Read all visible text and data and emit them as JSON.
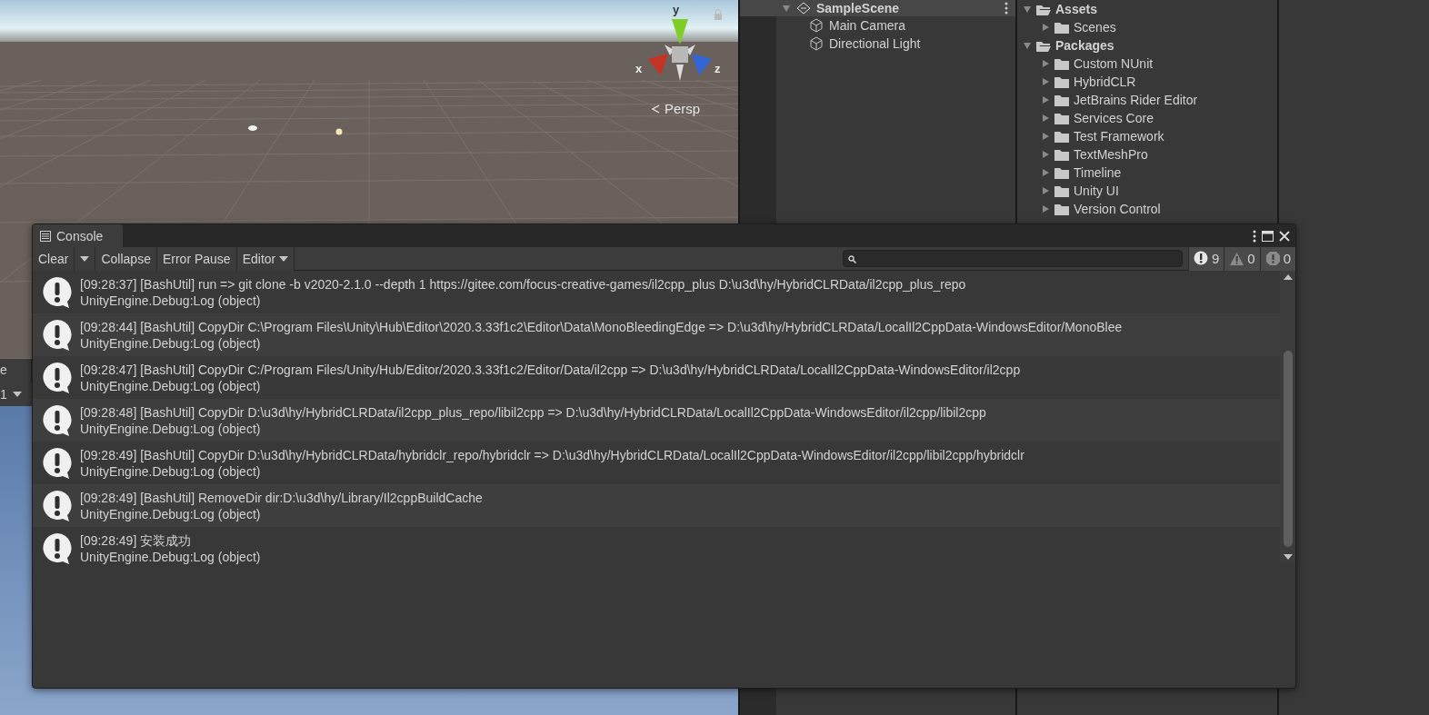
{
  "scene_view": {
    "gizmo_axes": [
      "y",
      "x",
      "z"
    ],
    "projection": "Persp"
  },
  "game_view": {
    "tab": "e",
    "display": "1"
  },
  "hierarchy": {
    "scene": "SampleScene",
    "items": [
      "Main Camera",
      "Directional Light"
    ]
  },
  "project": {
    "tree": [
      {
        "label": "Assets",
        "expanded": true,
        "children": [
          {
            "label": "Scenes",
            "expanded": false
          }
        ]
      },
      {
        "label": "Packages",
        "expanded": true,
        "children": [
          {
            "label": "Custom NUnit",
            "expanded": false
          },
          {
            "label": "HybridCLR",
            "expanded": false
          },
          {
            "label": "JetBrains Rider Editor",
            "expanded": false
          },
          {
            "label": "Services Core",
            "expanded": false
          },
          {
            "label": "Test Framework",
            "expanded": false
          },
          {
            "label": "TextMeshPro",
            "expanded": false
          },
          {
            "label": "Timeline",
            "expanded": false
          },
          {
            "label": "Unity UI",
            "expanded": false
          },
          {
            "label": "Version Control",
            "expanded": false
          }
        ]
      }
    ]
  },
  "console": {
    "title": "Console",
    "toolbar": {
      "clear": "Clear",
      "buttons": [
        "Collapse",
        "Error Pause"
      ],
      "dropdown": "Editor"
    },
    "counts": [
      {
        "kind": "info",
        "count": "9"
      },
      {
        "kind": "warning",
        "count": "0"
      },
      {
        "kind": "error",
        "count": "0"
      }
    ],
    "logs": [
      {
        "message": "[09:28:37] [BashUtil] run => git  clone  -b  v2020-2.1.0  --depth  1  https://gitee.com/focus-creative-games/il2cpp_plus  D:\\u3d\\hy/HybridCLRData/il2cpp_plus_repo",
        "source": "UnityEngine.Debug:Log (object)"
      },
      {
        "message": "[09:28:44] [BashUtil] CopyDir C:\\Program Files\\Unity\\Hub\\Editor\\2020.3.33f1c2\\Editor\\Data\\MonoBleedingEdge => D:\\u3d\\hy/HybridCLRData/LocalIl2CppData-WindowsEditor/MonoBlee",
        "source": "UnityEngine.Debug:Log (object)"
      },
      {
        "message": "[09:28:47] [BashUtil] CopyDir C:/Program Files/Unity/Hub/Editor/2020.3.33f1c2/Editor/Data/il2cpp => D:\\u3d\\hy/HybridCLRData/LocalIl2CppData-WindowsEditor/il2cpp",
        "source": "UnityEngine.Debug:Log (object)"
      },
      {
        "message": "[09:28:48] [BashUtil] CopyDir D:\\u3d\\hy/HybridCLRData/il2cpp_plus_repo/libil2cpp => D:\\u3d\\hy/HybridCLRData/LocalIl2CppData-WindowsEditor/il2cpp/libil2cpp",
        "source": "UnityEngine.Debug:Log (object)"
      },
      {
        "message": "[09:28:49] [BashUtil] CopyDir D:\\u3d\\hy/HybridCLRData/hybridclr_repo/hybridclr => D:\\u3d\\hy/HybridCLRData/LocalIl2CppData-WindowsEditor/il2cpp/libil2cpp/hybridclr",
        "source": "UnityEngine.Debug:Log (object)"
      },
      {
        "message": "[09:28:49] [BashUtil] RemoveDir dir:D:\\u3d\\hy/Library/Il2cppBuildCache",
        "source": "UnityEngine.Debug:Log (object)"
      },
      {
        "message": "[09:28:49] 安装成功",
        "source": "UnityEngine.Debug:Log (object)"
      }
    ]
  }
}
